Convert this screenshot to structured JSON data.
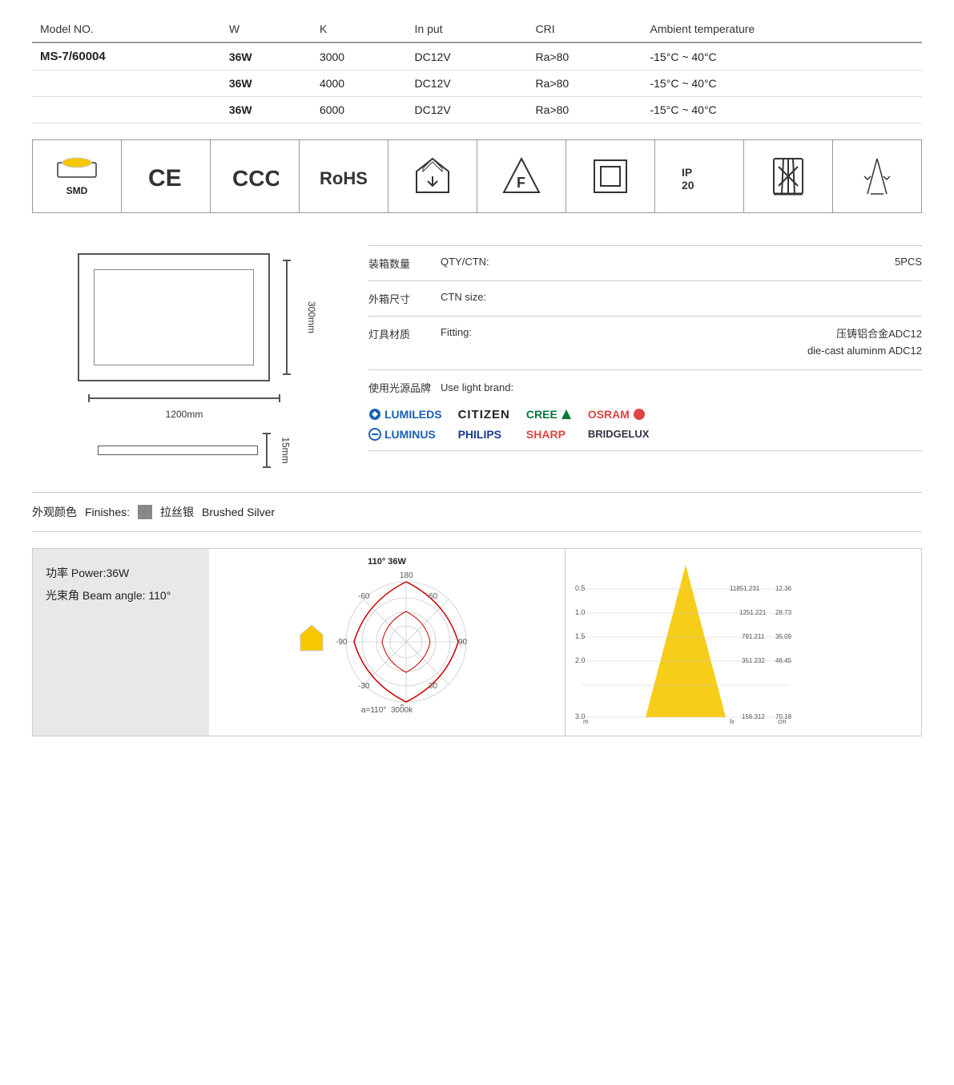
{
  "table": {
    "headers": [
      "Model NO.",
      "W",
      "K",
      "In put",
      "CRI",
      "Ambient temperature"
    ],
    "rows": [
      {
        "model": "MS-7/60004",
        "w": "36W",
        "k": "3000",
        "input": "DC12V",
        "cri": "Ra>80",
        "temp": "-15°C ~ 40°C"
      },
      {
        "model": "",
        "w": "36W",
        "k": "4000",
        "input": "DC12V",
        "cri": "Ra>80",
        "temp": "-15°C ~ 40°C"
      },
      {
        "model": "",
        "w": "36W",
        "k": "6000",
        "input": "DC12V",
        "cri": "Ra>80",
        "temp": "-15°C ~ 40°C"
      }
    ]
  },
  "certs": [
    {
      "label": "SMD",
      "type": "smd"
    },
    {
      "label": "CE",
      "type": "ce"
    },
    {
      "label": "CCC",
      "type": "ccc"
    },
    {
      "label": "RoHS",
      "type": "rohs"
    },
    {
      "label": "",
      "type": "recycle_arrow"
    },
    {
      "label": "",
      "type": "flame_triangle"
    },
    {
      "label": "",
      "type": "square_box"
    },
    {
      "label": "IP\n20",
      "type": "ip20"
    },
    {
      "label": "",
      "type": "weee"
    },
    {
      "label": "",
      "type": "fragile"
    }
  ],
  "dimensions": {
    "width": "1200mm",
    "height": "300mm",
    "depth": "15mm"
  },
  "spec_info": {
    "qty_label_cn": "装箱数量",
    "qty_label_en": "QTY/CTN:",
    "qty_value": "5PCS",
    "ctn_label_cn": "外箱尺寸",
    "ctn_label_en": "CTN size:",
    "ctn_value": "",
    "fitting_label_cn": "灯具材质",
    "fitting_label_en": "Fitting:",
    "fitting_value_cn": "压铸铝合金ADC12",
    "fitting_value_en": "die-cast aluminm ADC12",
    "brand_label_cn": "使用光源品牌",
    "brand_label_en": "Use light brand:"
  },
  "brands": {
    "row1": [
      "LUMILEDS",
      "CITIZEN",
      "CREE",
      "OSRAM"
    ],
    "row2": [
      "LUMINUS",
      "PHILIPS",
      "SHARP",
      "BRIDGELUX"
    ]
  },
  "finishes": {
    "label_cn": "外观颜色",
    "label_en": "Finishes:",
    "color_cn": "拉丝银",
    "color_en": "Brushed Silver"
  },
  "power_info": {
    "power_cn": "功率",
    "power_en": "Power:36W",
    "angle_cn": "光束角",
    "angle_en": "Beam angle: 110°"
  },
  "polar_chart": {
    "title": "110°  36W",
    "angle_label": "a=110°",
    "kelvin_label": "3000k",
    "labels": {
      "top": "180",
      "right": "90",
      "bottom": "0",
      "left": "-90",
      "tl": "-60",
      "tr": "60",
      "bl": "-30",
      "br": "30"
    }
  },
  "cone_chart": {
    "data": [
      {
        "m": "0.5",
        "lx": "11851.231",
        "cm": "12.36"
      },
      {
        "m": "1.0",
        "lx": "1251.221",
        "cm": "28.73"
      },
      {
        "m": "1.5",
        "lx": "791.211",
        "cm": "35.09"
      },
      {
        "m": "2.0",
        "lx": "351.232",
        "cm": "46.45"
      },
      {
        "m": "3.0",
        "lx": "156.312",
        "cm": "70.18"
      }
    ],
    "col_m": "m",
    "col_lx": "lx",
    "col_cm": "cm"
  }
}
